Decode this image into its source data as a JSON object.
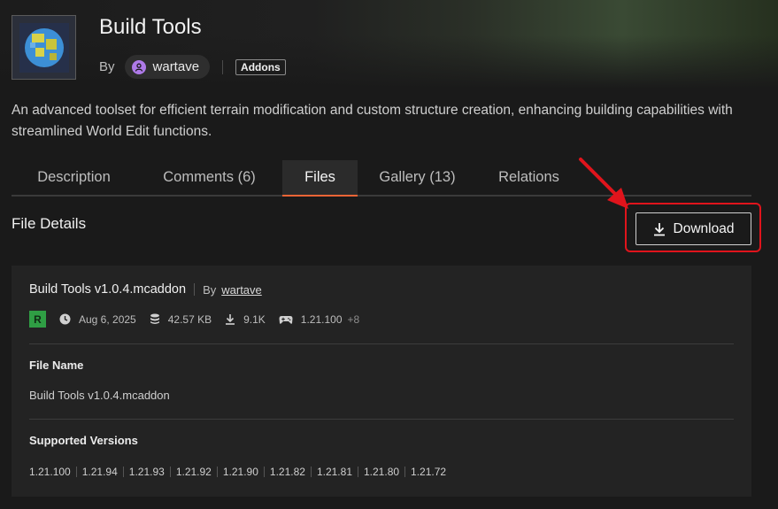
{
  "header": {
    "title": "Build Tools",
    "by_label": "By",
    "author": "wartave",
    "category_tag": "Addons"
  },
  "summary": "An advanced toolset for efficient terrain modification and custom structure creation, enhancing building capabilities with streamlined World Edit functions.",
  "tabs": [
    {
      "label": "Description"
    },
    {
      "label": "Comments (6)"
    },
    {
      "label": "Files",
      "active": true
    },
    {
      "label": "Gallery (13)"
    },
    {
      "label": "Relations"
    }
  ],
  "file_details": {
    "heading": "File Details",
    "download_label": "Download"
  },
  "file": {
    "name": "Build Tools v1.0.4.mcaddon",
    "by_label": "By",
    "author": "wartave",
    "release_badge": "R",
    "date": "Aug 6, 2025",
    "size": "42.57 KB",
    "downloads": "9.1K",
    "game_version": "1.21.100",
    "extra_versions": "+8",
    "file_name_label": "File Name",
    "file_name_value": "Build Tools v1.0.4.mcaddon",
    "supported_label": "Supported Versions",
    "supported_versions": [
      "1.21.100",
      "1.21.94",
      "1.21.93",
      "1.21.92",
      "1.21.90",
      "1.21.82",
      "1.21.81",
      "1.21.80",
      "1.21.72"
    ]
  },
  "colors": {
    "accent": "#f16436",
    "highlight": "#e0141c",
    "release_green": "#2f9e44"
  }
}
